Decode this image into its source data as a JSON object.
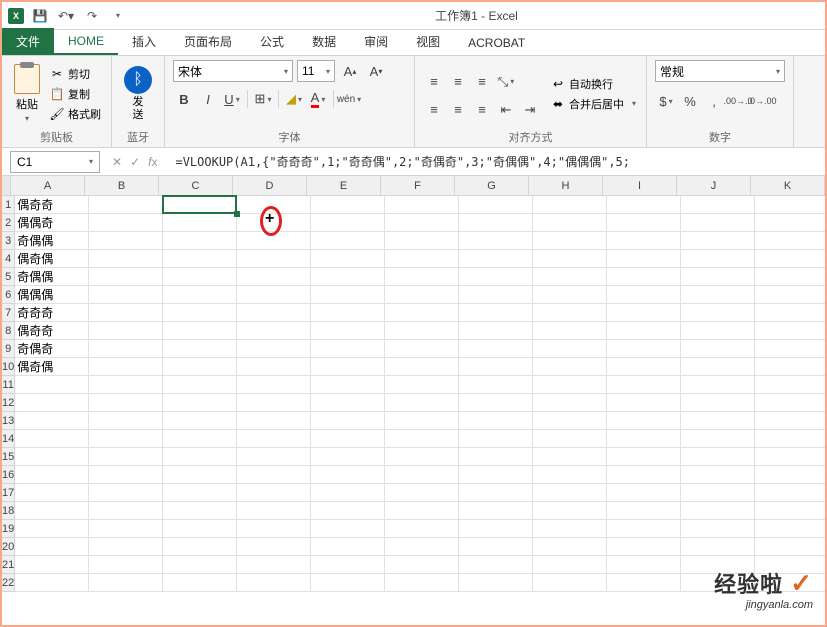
{
  "title": "工作簿1 - Excel",
  "tabs": {
    "file": "文件",
    "home": "HOME",
    "insert": "插入",
    "page_layout": "页面布局",
    "formulas": "公式",
    "data": "数据",
    "review": "审阅",
    "view": "视图",
    "acrobat": "ACROBAT"
  },
  "ribbon": {
    "clipboard": {
      "paste": "粘贴",
      "cut": "剪切",
      "copy": "复制",
      "format_painter": "格式刷",
      "label": "剪贴板"
    },
    "bluetooth": {
      "send": "发\n送",
      "label": "蓝牙"
    },
    "font": {
      "name": "宋体",
      "size": "11",
      "label": "字体"
    },
    "alignment": {
      "wrap": "自动换行",
      "merge": "合并后居中",
      "label": "对齐方式"
    },
    "number": {
      "format": "常规",
      "label": "数字"
    }
  },
  "formula_bar": {
    "cell_ref": "C1",
    "formula": "=VLOOKUP(A1,{\"奇奇奇\",1;\"奇奇偶\",2;\"奇偶奇\",3;\"奇偶偶\",4;\"偶偶偶\",5;"
  },
  "columns": [
    "A",
    "B",
    "C",
    "D",
    "E",
    "F",
    "G",
    "H",
    "I",
    "J",
    "K"
  ],
  "rows": [
    1,
    2,
    3,
    4,
    5,
    6,
    7,
    8,
    9,
    10,
    11,
    12,
    13,
    14,
    15,
    16,
    17,
    18,
    19,
    20,
    21,
    22
  ],
  "data_a": [
    "偶奇奇",
    "偶偶奇",
    "奇偶偶",
    "偶奇偶",
    "奇偶偶",
    "偶偶偶",
    "奇奇奇",
    "偶奇奇",
    "奇偶奇",
    "偶奇偶"
  ],
  "watermark": {
    "main": "经验啦",
    "sub": "jingyanla.com"
  }
}
